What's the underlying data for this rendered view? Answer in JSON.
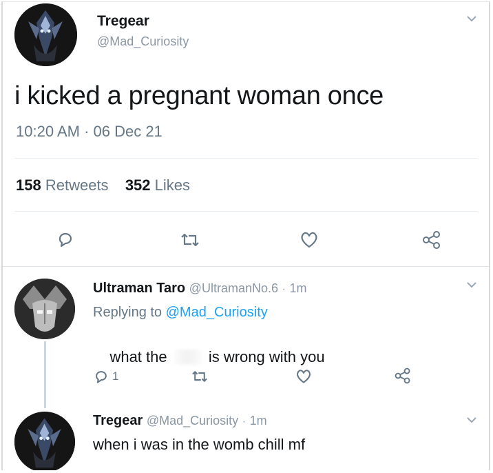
{
  "main_tweet": {
    "author_name": "Tregear",
    "author_handle": "@Mad_Curiosity",
    "text": "i kicked a pregnant woman once",
    "timestamp": "10:20 AM · 06 Dec 21",
    "retweet_count": "158",
    "retweet_label": "Retweets",
    "like_count": "352",
    "like_label": "Likes"
  },
  "replies": [
    {
      "author_name": "Ultraman Taro",
      "author_handle": "@UltramanNo.6",
      "time_sep": "·",
      "time": "1m",
      "replying_to_label": "Replying to",
      "replying_to_handle": "@Mad_Curiosity",
      "text_before": "what the ",
      "text_after": " is wrong with you",
      "reply_count": "1"
    },
    {
      "author_name": "Tregear",
      "author_handle": "@Mad_Curiosity",
      "time_sep": "·",
      "time": "1m",
      "text": "when i was in the womb chill mf"
    }
  ],
  "icons": {
    "more": "chevron-down-icon",
    "reply": "reply-icon",
    "retweet": "retweet-icon",
    "like": "heart-icon",
    "share": "share-icon"
  },
  "colors": {
    "text": "#14171a",
    "secondary": "#657786",
    "link": "#1da1f2",
    "divider": "#e6ecf0"
  }
}
